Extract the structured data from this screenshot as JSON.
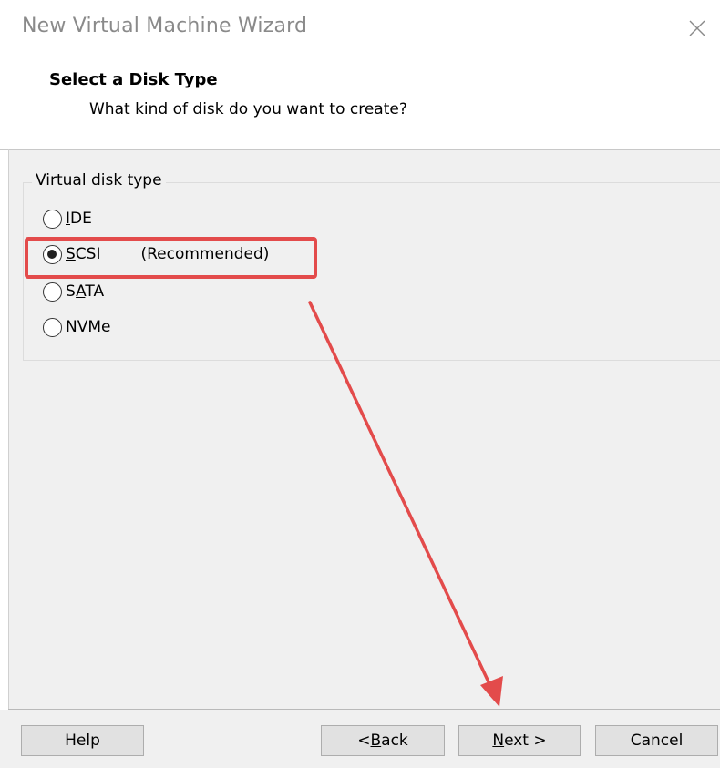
{
  "window": {
    "title": "New Virtual Machine Wizard",
    "close_icon": "close-icon"
  },
  "header": {
    "title": "Select a Disk Type",
    "subtitle": "What kind of disk do you want to create?"
  },
  "disk_type": {
    "group_label": "Virtual disk type",
    "options": [
      {
        "pre": "",
        "accel": "I",
        "post": "DE",
        "note": "",
        "checked": false
      },
      {
        "pre": "",
        "accel": "S",
        "post": "CSI",
        "note": "(Recommended)",
        "checked": true
      },
      {
        "pre": "S",
        "accel": "A",
        "post": "TA",
        "note": "",
        "checked": false
      },
      {
        "pre": "N",
        "accel": "V",
        "post": "Me",
        "note": "",
        "checked": false
      }
    ],
    "selected": "SCSI"
  },
  "buttons": {
    "help": {
      "pre": "Help",
      "accel": "",
      "post": ""
    },
    "back": {
      "pre": "< ",
      "accel": "B",
      "post": "ack"
    },
    "next": {
      "pre": "",
      "accel": "N",
      "post": "ext >"
    },
    "cancel": {
      "pre": "Cancel",
      "accel": "",
      "post": ""
    }
  },
  "annotation": {
    "color": "#e34b4b"
  }
}
